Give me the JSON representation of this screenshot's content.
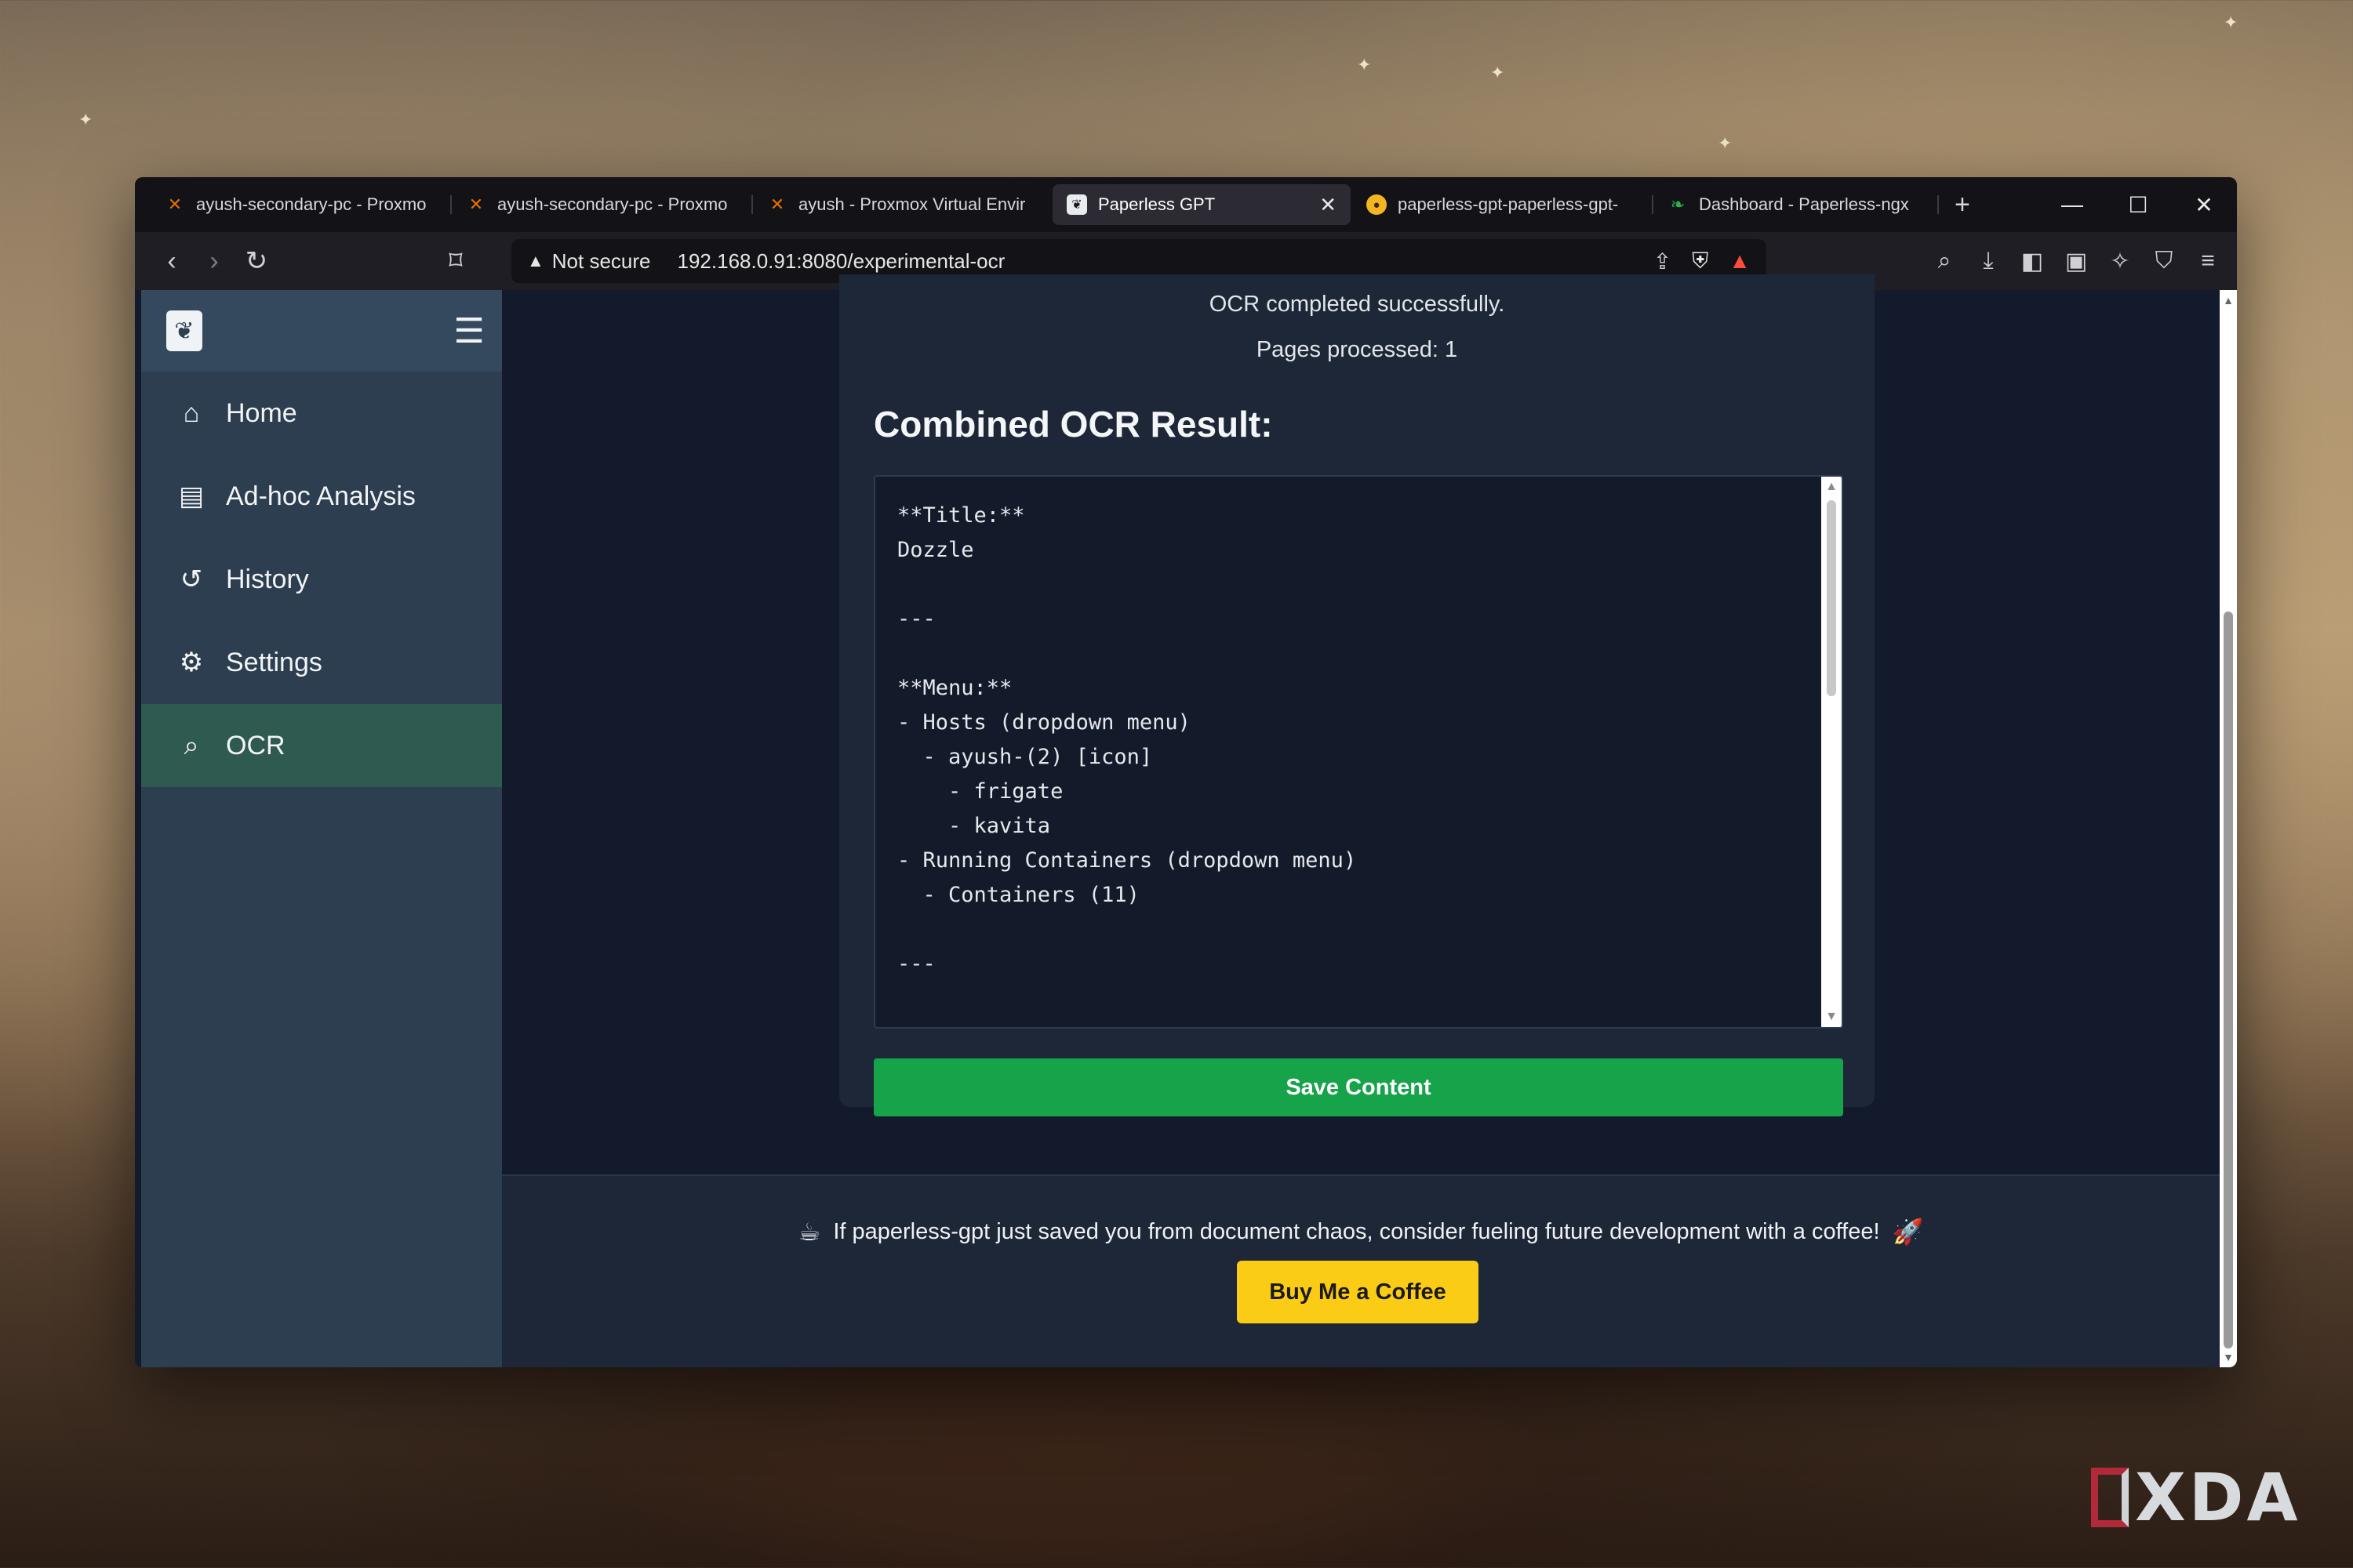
{
  "browser": {
    "tabs": [
      {
        "title": "ayush-secondary-pc - Proxmo",
        "icon": "proxmox-icon",
        "active": false
      },
      {
        "title": "ayush-secondary-pc - Proxmo",
        "icon": "proxmox-icon",
        "active": false
      },
      {
        "title": "ayush - Proxmox Virtual Envir",
        "icon": "proxmox-icon",
        "active": false
      },
      {
        "title": "Paperless GPT",
        "icon": "paperless-icon",
        "active": true
      },
      {
        "title": "paperless-gpt-paperless-gpt-",
        "icon": "dozzle-icon",
        "active": false
      },
      {
        "title": "Dashboard - Paperless-ngx",
        "icon": "leaf-icon",
        "active": false
      }
    ],
    "security_label": "Not secure",
    "url": "192.168.0.91:8080/experimental-ocr"
  },
  "sidebar": {
    "items": [
      {
        "label": "Home",
        "icon": "home-icon"
      },
      {
        "label": "Ad-hoc Analysis",
        "icon": "document-chart-icon"
      },
      {
        "label": "History",
        "icon": "history-icon"
      },
      {
        "label": "Settings",
        "icon": "gear-icon"
      },
      {
        "label": "OCR",
        "icon": "ocr-search-icon",
        "active": true
      }
    ]
  },
  "main": {
    "status_message": "OCR completed successfully.",
    "pages_processed": "Pages processed: 1",
    "result_title": "Combined OCR Result:",
    "ocr_result": "**Title:**\nDozzle\n\n---\n\n**Menu:**\n- Hosts (dropdown menu)\n  - ayush-(2) [icon]\n    - frigate\n    - kavita\n- Running Containers (dropdown menu)\n  - Containers (11)\n\n---",
    "save_label": "Save Content"
  },
  "footer": {
    "message": "If paperless-gpt just saved you from document chaos, consider fueling future development with a coffee!",
    "coffee_label": "Buy Me a Coffee"
  },
  "colors": {
    "sidebar_bg": "#2c3e50",
    "active_item_bg": "#2f5a4f",
    "page_bg": "#121a2b",
    "save_button": "#16a34a",
    "coffee_button": "#facc15"
  },
  "watermark": "XDA"
}
